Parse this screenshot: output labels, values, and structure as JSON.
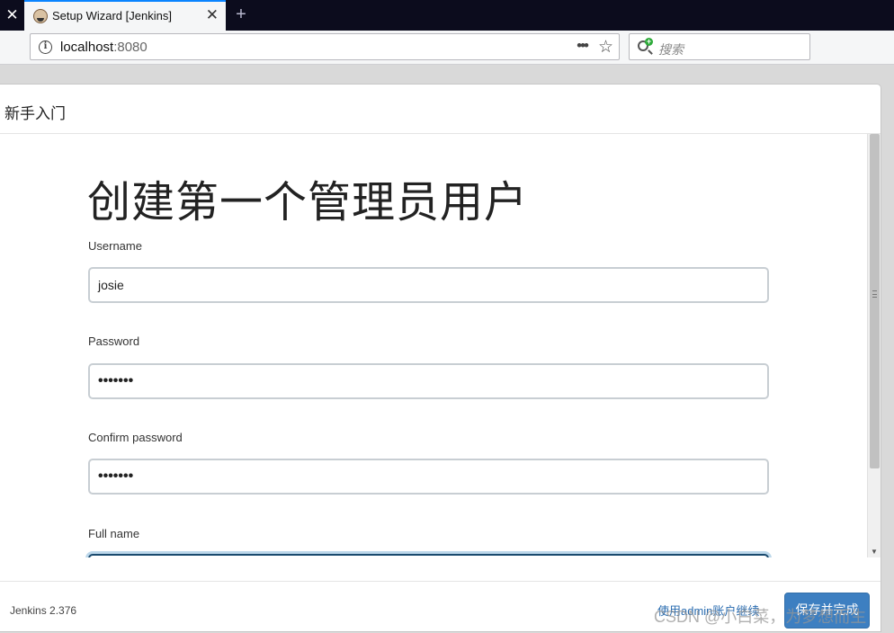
{
  "browser": {
    "tab_title": "Setup Wizard [Jenkins]",
    "url_host": "localhost",
    "url_port": ":8080",
    "search_placeholder": "搜索",
    "new_tab_symbol": "+",
    "close_symbol": "✕",
    "more_symbol": "•••",
    "star_symbol": "☆",
    "icons": [
      "jenkins-favicon",
      "info-icon",
      "more-icon",
      "bookmark-star-icon",
      "search-icon",
      "close-icon",
      "new-tab-icon"
    ]
  },
  "dialog": {
    "title": "新手入门",
    "heading": "创建第一个管理员用户",
    "fields": [
      {
        "label": "Username",
        "value": "josie"
      },
      {
        "label": "Password",
        "value": "•••••••"
      },
      {
        "label": "Confirm password",
        "value": "•••••••"
      },
      {
        "label": "Full name",
        "value": ""
      }
    ],
    "footer": {
      "version": "Jenkins 2.376",
      "admin_link": "使用admin账户继续",
      "save_button": "保存并完成"
    }
  },
  "watermark": "CSDN @小白菜，为梦想而生",
  "colors": {
    "tab_accent": "#0a84ff",
    "primary_button": "#3d7fc1",
    "link": "#2a6cb0",
    "focus_border": "#1a4a6e"
  }
}
